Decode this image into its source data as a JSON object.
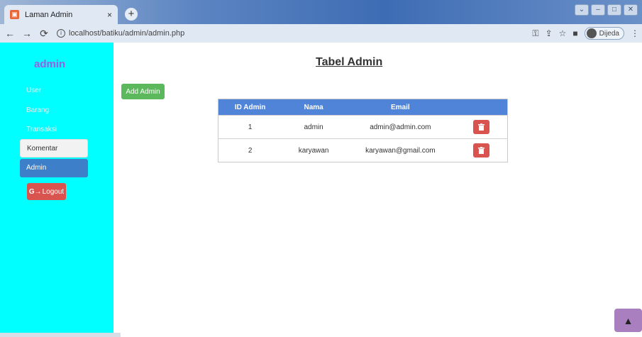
{
  "browser": {
    "tab_title": "Laman Admin",
    "tab_close": "×",
    "new_tab": "+",
    "url": "localhost/batiku/admin/admin.php",
    "profile_label": "Dijeda"
  },
  "sidebar": {
    "brand": "admin",
    "items": [
      {
        "label": "User"
      },
      {
        "label": "Barang"
      },
      {
        "label": "Transaksi"
      },
      {
        "label": "Komentar"
      },
      {
        "label": "Admin"
      }
    ],
    "logout_label": "Logout"
  },
  "main": {
    "title": "Tabel Admin",
    "add_button": "Add Admin",
    "table": {
      "headers": [
        "ID Admin",
        "Nama",
        "Email",
        ""
      ],
      "rows": [
        {
          "id": "1",
          "nama": "admin",
          "email": "admin@admin.com"
        },
        {
          "id": "2",
          "nama": "karyawan",
          "email": "karyawan@gmail.com"
        }
      ]
    }
  },
  "colors": {
    "sidebar_bg": "#00ffff",
    "brand": "#9b5de5",
    "active_item": "#3d7fc8",
    "header_bg": "#4f84d8",
    "delete": "#d9534f",
    "add": "#5cb85c"
  }
}
